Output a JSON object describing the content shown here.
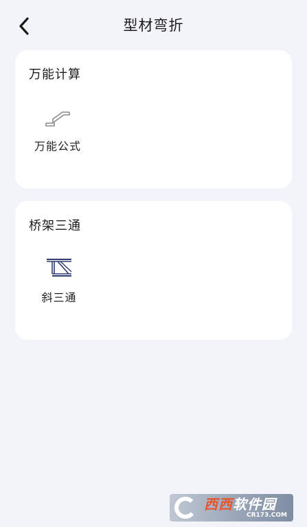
{
  "header": {
    "title": "型材弯折",
    "back_icon": "chevron-left-icon"
  },
  "sections": [
    {
      "title": "万能计算",
      "tools": [
        {
          "label": "万能公式",
          "icon": "z-bend-profile-icon",
          "color": "#8a8a8a"
        }
      ]
    },
    {
      "title": "桥架三通",
      "tools": [
        {
          "label": "斜三通",
          "icon": "slant-tee-icon",
          "color": "#2e3a6e"
        }
      ]
    }
  ],
  "watermark": {
    "brand_part1": "西西",
    "brand_part2": "软件园",
    "url": "CR173.COM"
  },
  "colors": {
    "background": "#f3f4f9",
    "card": "#ffffff",
    "text": "#1c1c1c",
    "watermark_accent": "#e8552b"
  }
}
